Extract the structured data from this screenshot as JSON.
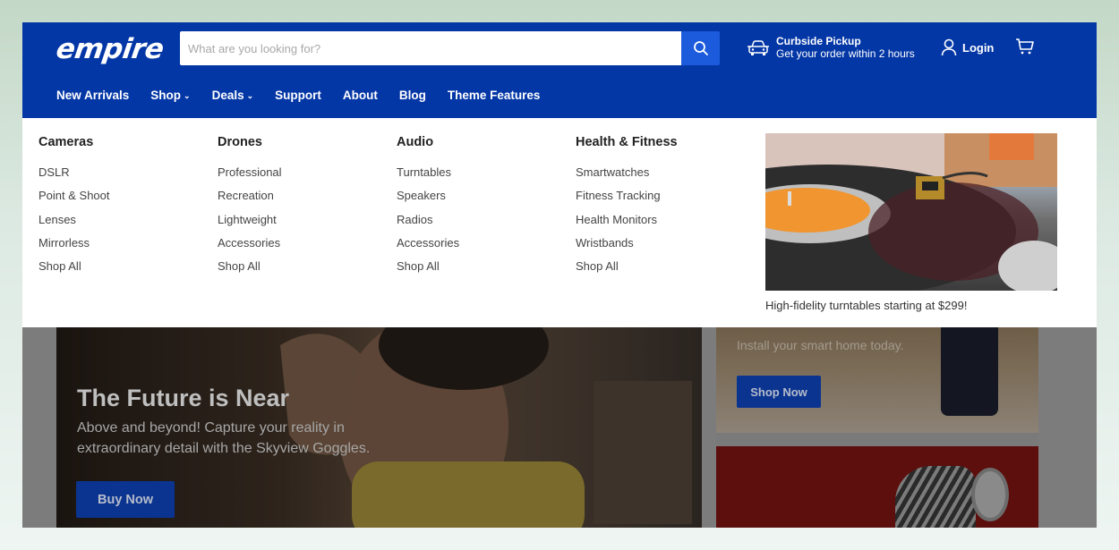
{
  "header": {
    "logo": "empire",
    "search": {
      "placeholder": "What are you looking for?",
      "value": ""
    },
    "pickup": {
      "title": "Curbside Pickup",
      "subtitle": "Get your order within 2 hours"
    },
    "login_label": "Login"
  },
  "nav": [
    {
      "label": "New Arrivals",
      "has_dropdown": false
    },
    {
      "label": "Shop",
      "has_dropdown": true
    },
    {
      "label": "Deals",
      "has_dropdown": true
    },
    {
      "label": "Support",
      "has_dropdown": false
    },
    {
      "label": "About",
      "has_dropdown": false
    },
    {
      "label": "Blog",
      "has_dropdown": false
    },
    {
      "label": "Theme Features",
      "has_dropdown": false
    }
  ],
  "mega_menu": {
    "columns": [
      {
        "title": "Cameras",
        "items": [
          "DSLR",
          "Point & Shoot",
          "Lenses",
          "Mirrorless",
          "Shop All"
        ]
      },
      {
        "title": "Drones",
        "items": [
          "Professional",
          "Recreation",
          "Lightweight",
          "Accessories",
          "Shop All"
        ]
      },
      {
        "title": "Audio",
        "items": [
          "Turntables",
          "Speakers",
          "Radios",
          "Accessories",
          "Shop All"
        ]
      },
      {
        "title": "Health & Fitness",
        "items": [
          "Smartwatches",
          "Fitness Tracking",
          "Health Monitors",
          "Wristbands",
          "Shop All"
        ]
      }
    ],
    "promo": {
      "image": "turntable-photo",
      "caption": "High-fidelity turntables starting at $299!"
    }
  },
  "hero": {
    "title": "The Future is Near",
    "text": "Above and beyond! Capture your reality in extraordinary detail with the Skyview Goggles.",
    "button": "Buy Now"
  },
  "side_banner_1": {
    "text": "Install your smart home today.",
    "button": "Shop Now"
  },
  "side_banner_2": {
    "image": "zebra-headphones-photo"
  },
  "colors": {
    "brand": "#0437a6",
    "search_button": "#1c5bdc"
  }
}
